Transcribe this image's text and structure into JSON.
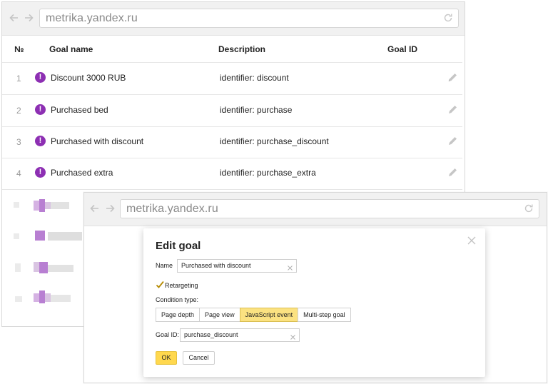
{
  "back_window": {
    "url": "metrika.yandex.ru",
    "table": {
      "headers": {
        "num": "№",
        "goal_name": "Goal name",
        "description": "Description",
        "goal_id": "Goal ID"
      },
      "rows": [
        {
          "num": "1",
          "badge": "!",
          "name": "Discount 3000 RUB",
          "description": "identifier: discount"
        },
        {
          "num": "2",
          "badge": "!",
          "name": "Purchased bed",
          "description": "identifier: purchase"
        },
        {
          "num": "3",
          "badge": "!",
          "name": "Purchased with discount",
          "description": "identifier: purchase_discount"
        },
        {
          "num": "4",
          "badge": "!",
          "name": "Purchased extra",
          "description": "identifier: purchase_extra"
        }
      ]
    }
  },
  "front_window": {
    "url": "metrika.yandex.ru"
  },
  "dialog": {
    "title": "Edit goal",
    "name_label": "Name",
    "name_value": "Purchased with discount",
    "retargeting_label": "Retargeting",
    "retargeting_checked": true,
    "condition_label": "Condition type:",
    "condition_options": [
      "Page depth",
      "Page view",
      "JavaScript event",
      "Multi-step goal"
    ],
    "condition_selected": "JavaScript event",
    "goal_id_label": "Goal ID:",
    "goal_id_value": "purchase_discount",
    "ok_label": "OK",
    "cancel_label": "Cancel"
  },
  "colors": {
    "badge": "#8d2fb3",
    "active_segment": "#fbe281",
    "ok_button": "#ffd84e",
    "url_text": "#8a8a8a"
  },
  "icons": [
    "back-arrow-icon",
    "forward-arrow-icon",
    "reload-icon",
    "exclamation-badge-icon",
    "pencil-icon",
    "close-icon",
    "checkmark-icon",
    "clear-icon"
  ]
}
